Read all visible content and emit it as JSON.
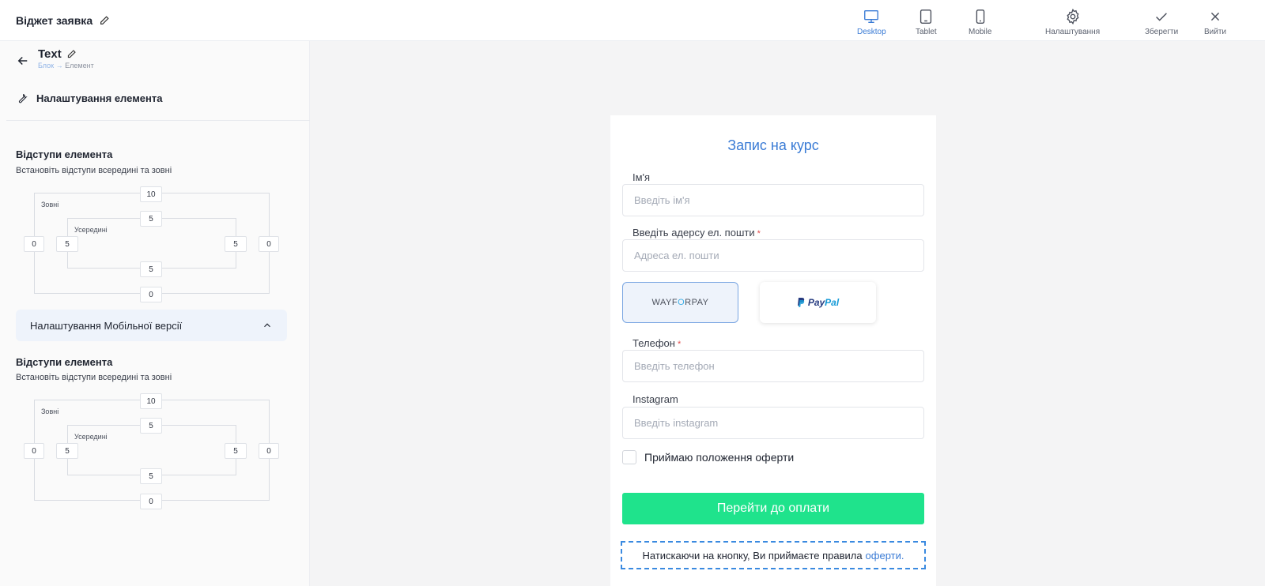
{
  "header": {
    "widget_title": "Віджет заявка",
    "actions": {
      "desktop": "Desktop",
      "tablet": "Tablet",
      "mobile": "Mobile",
      "settings": "Налаштування",
      "save": "Зберегти",
      "exit": "Вийти"
    },
    "active_view": "Desktop",
    "accent_color": "#3a7bd5"
  },
  "sidebar": {
    "element_title": "Text",
    "breadcrumb": {
      "parent": "Блок",
      "separator": "→",
      "current": "Елемент"
    },
    "settings_heading": "Налаштування елемента",
    "spacing_sections": [
      {
        "title": "Відступи елемента",
        "subtitle": "Встановіть відступи всередині та зовні",
        "outer_label": "Зовні",
        "inner_label": "Усередині",
        "outer": {
          "top": "10",
          "right": "0",
          "bottom": "0",
          "left": "0"
        },
        "inner": {
          "top": "5",
          "right": "5",
          "bottom": "5",
          "left": "5"
        }
      },
      {
        "title": "Відступи елемента",
        "subtitle": "Встановіть відступи всередині та зовні",
        "outer_label": "Зовні",
        "inner_label": "Усередині",
        "outer": {
          "top": "10",
          "right": "0",
          "bottom": "0",
          "left": "0"
        },
        "inner": {
          "top": "5",
          "right": "5",
          "bottom": "5",
          "left": "5"
        }
      }
    ],
    "mobile_settings_label": "Налаштування Мобільної версії"
  },
  "form": {
    "title": "Запис на курс",
    "fields": {
      "name": {
        "label": "Ім'я",
        "placeholder": "Введіть ім'я"
      },
      "email": {
        "label": "Введіть адерсу ел. пошти",
        "required_mark": "*",
        "placeholder": "Адреса ел. пошти"
      },
      "phone": {
        "label": "Телефон",
        "required_mark": "*",
        "placeholder": "Введіть телефон"
      },
      "instagram": {
        "label": "Instagram",
        "placeholder": "Введіть instagram"
      }
    },
    "payment": {
      "wayforpay": {
        "part1": "WAYF",
        "o": "O",
        "part2": "RPAY"
      },
      "paypal": {
        "pay": "Pay",
        "pal": "Pal"
      }
    },
    "checkbox_label": "Приймаю положення оферти",
    "submit_label": "Перейти до оплати",
    "submit_color": "#1fe38c",
    "terms_text": "Натискаючи на кнопку, Ви приймаєте правила",
    "terms_link": "оферти."
  }
}
